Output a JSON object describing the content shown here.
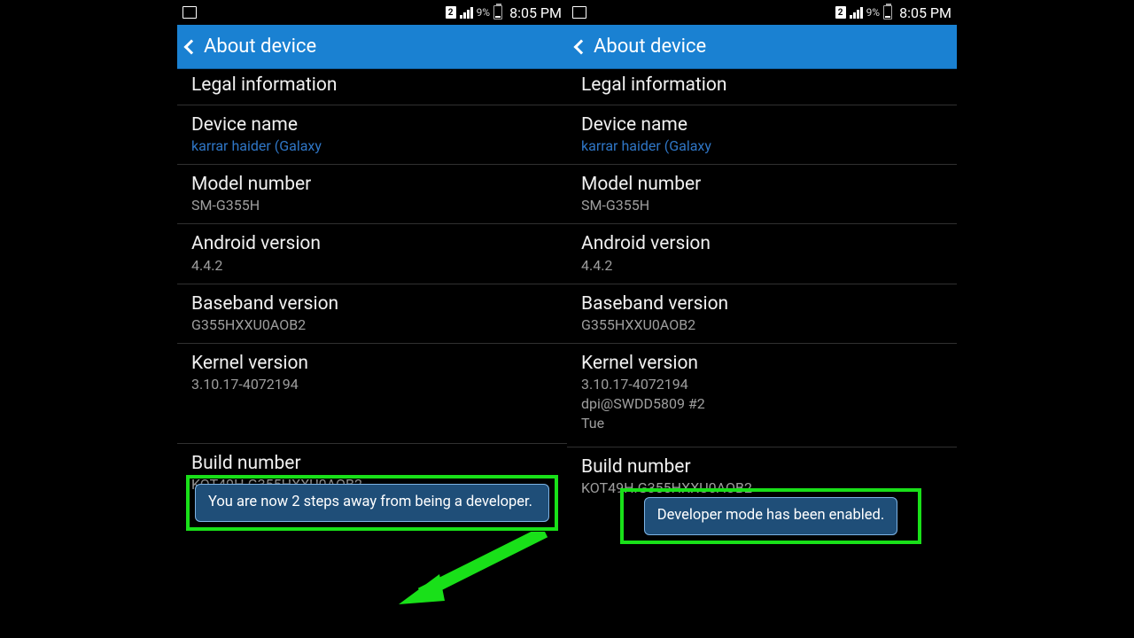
{
  "statusbar": {
    "sim": "2",
    "battery_pct": "9%",
    "time": "8:05 PM"
  },
  "header": {
    "title": "About device"
  },
  "rows": {
    "legal": {
      "title": "Legal information"
    },
    "devname": {
      "title": "Device name",
      "sub": "karrar haider (Galaxy"
    },
    "model": {
      "title": "Model number",
      "sub": "SM-G355H"
    },
    "android": {
      "title": "Android version",
      "sub": "4.4.2"
    },
    "baseband": {
      "title": "Baseband version",
      "sub": "G355HXXU0AOB2"
    },
    "kernel": {
      "title": "Kernel version",
      "sub": "3.10.17-4072194"
    },
    "kernel_extra_left": "",
    "kernel_extra_right1": "dpi@SWDD5809 #2",
    "kernel_extra_right2": "Tue",
    "build": {
      "title": "Build number",
      "sub": "KOT49H.G355HXXU0AOB2"
    }
  },
  "toast_left": "You are now 2 steps away from being a developer.",
  "toast_right": "Developer mode has been enabled.",
  "colors": {
    "header": "#1a81d2",
    "toast_bg": "#1f4e78",
    "highlight": "#19e019",
    "link": "#2f76c6"
  }
}
